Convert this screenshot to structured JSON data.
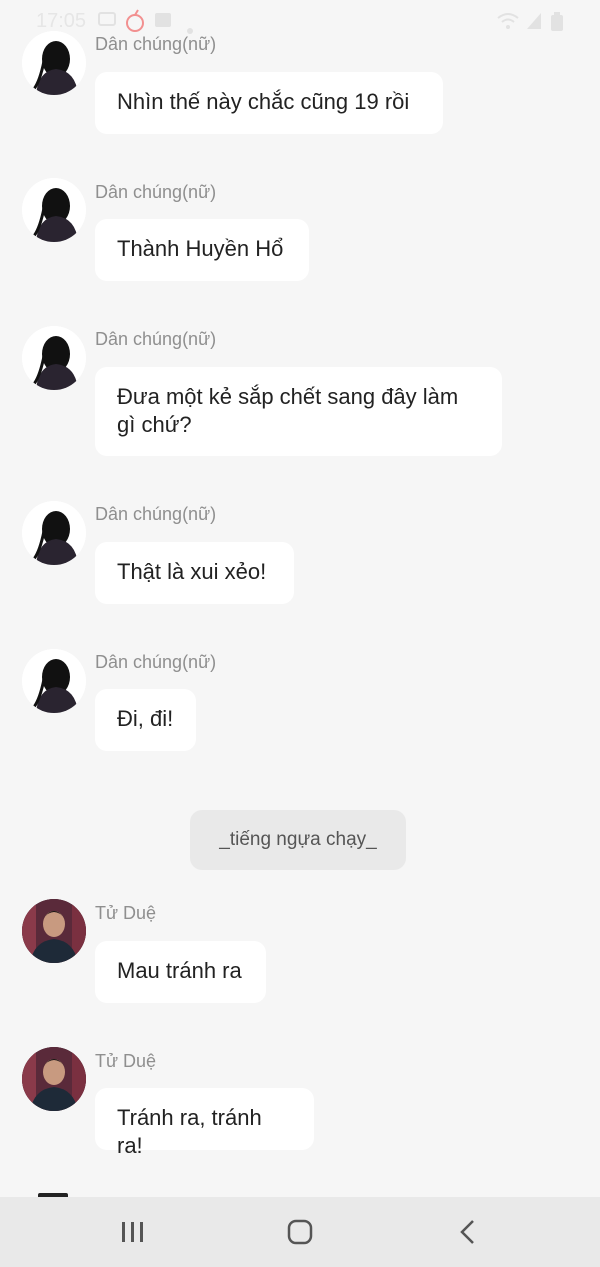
{
  "status_bar": {
    "time": "17:05",
    "icons": [
      "message-icon",
      "apple-icon",
      "gallery-icon",
      "dot-icon",
      "wifi-icon",
      "signal-icon",
      "battery-icon"
    ]
  },
  "messages": [
    {
      "sender": "Dân chúng(nữ)",
      "text": "Nhìn thế này chắc cũng 19 rồi",
      "avatar": "silhouette"
    },
    {
      "sender": "Dân chúng(nữ)",
      "text": "Thành Huyền Hổ",
      "avatar": "silhouette"
    },
    {
      "sender": "Dân chúng(nữ)",
      "text": "Đưa một kẻ sắp chết sang đây làm gì chứ?",
      "avatar": "silhouette"
    },
    {
      "sender": "Dân chúng(nữ)",
      "text": "Thật là xui xẻo!",
      "avatar": "silhouette"
    },
    {
      "sender": "Dân chúng(nữ)",
      "text": "Đi, đi!",
      "avatar": "silhouette"
    }
  ],
  "narration": "_tiếng ngựa chạy_",
  "messages2": [
    {
      "sender": "Tử Duệ",
      "text": "Mau tránh ra",
      "avatar": "portrait"
    },
    {
      "sender": "Tử Duệ",
      "text": "Tránh ra, tránh ra!",
      "avatar": "portrait"
    }
  ],
  "navbar": {
    "recents_label": "recent-apps-icon",
    "home_label": "home-icon",
    "back_label": "back-icon"
  }
}
